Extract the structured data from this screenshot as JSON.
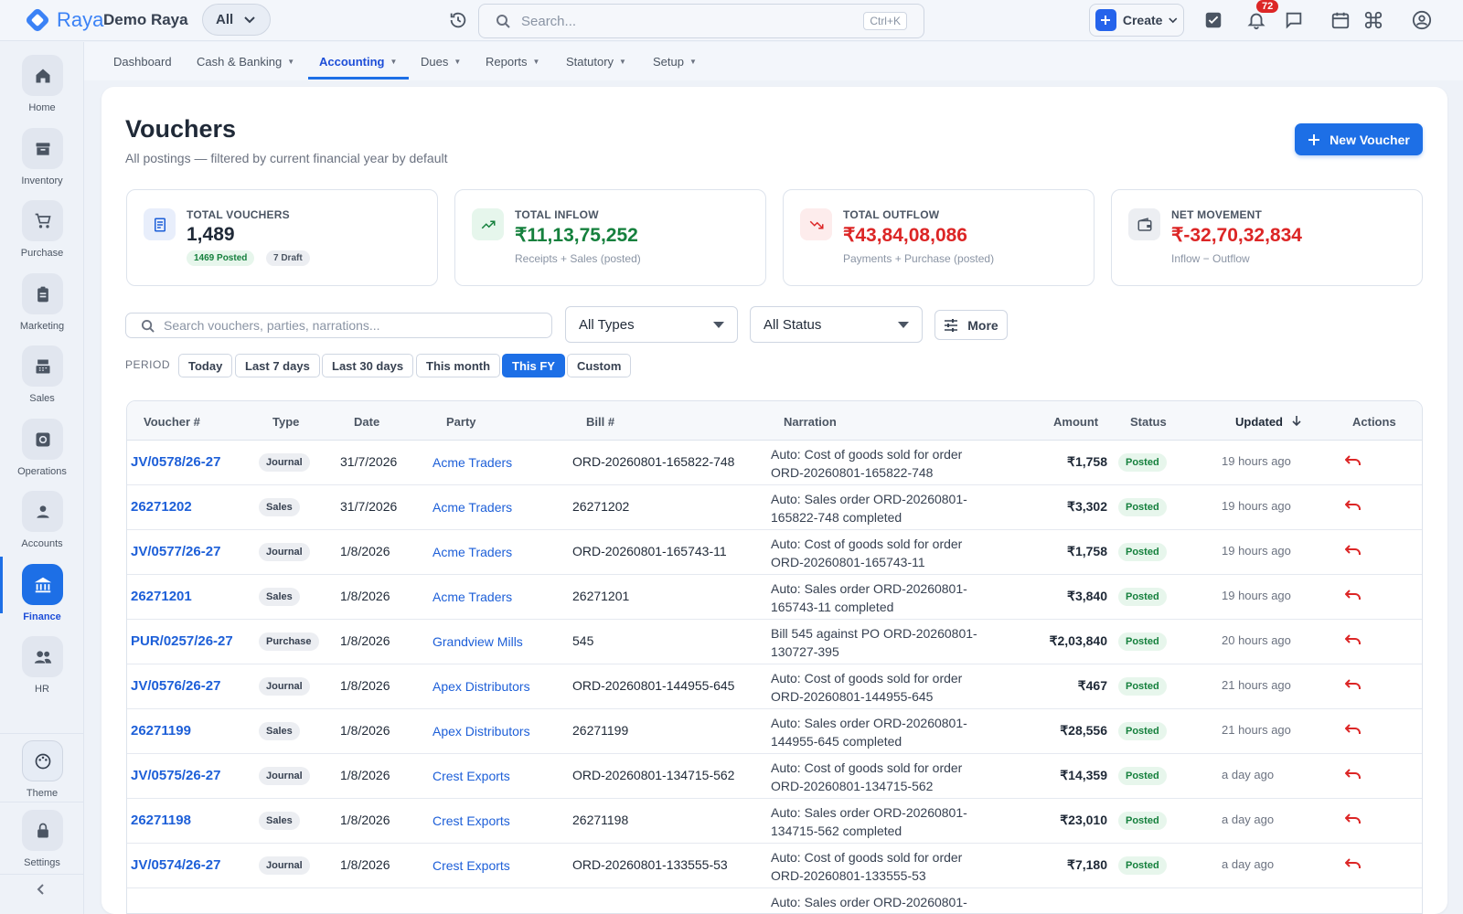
{
  "app": {
    "brand": "Raya",
    "company": "Demo Raya",
    "scope": "All",
    "search_placeholder": "Search...",
    "search_shortcut": "Ctrl+K",
    "create_label": "Create",
    "notification_count": "72"
  },
  "sidebar": {
    "items": [
      {
        "label": "Home",
        "icon": "home-icon"
      },
      {
        "label": "Inventory",
        "icon": "archive-icon"
      },
      {
        "label": "Purchase",
        "icon": "cart-icon"
      },
      {
        "label": "Marketing",
        "icon": "clipboard-icon"
      },
      {
        "label": "Sales",
        "icon": "register-icon"
      },
      {
        "label": "Operations",
        "icon": "gear-icon"
      },
      {
        "label": "Accounts",
        "icon": "person-icon"
      },
      {
        "label": "Finance",
        "icon": "bank-icon",
        "active": true
      },
      {
        "label": "HR",
        "icon": "people-icon"
      }
    ],
    "theme_label": "Theme",
    "settings_label": "Settings"
  },
  "subnav": {
    "tabs": [
      {
        "label": "Dashboard",
        "has_menu": false
      },
      {
        "label": "Cash & Banking",
        "has_menu": true
      },
      {
        "label": "Accounting",
        "has_menu": true,
        "active": true
      },
      {
        "label": "Dues",
        "has_menu": true
      },
      {
        "label": "Reports",
        "has_menu": true
      },
      {
        "label": "Statutory",
        "has_menu": true
      },
      {
        "label": "Setup",
        "has_menu": true
      }
    ]
  },
  "page": {
    "title": "Vouchers",
    "subtitle": "All postings — filtered by current financial year by default",
    "new_button": "New Voucher"
  },
  "stats": [
    {
      "label": "TOTAL VOUCHERS",
      "value": "1,489",
      "posted": "1469 Posted",
      "draft": "7 Draft",
      "color": "#1f2937"
    },
    {
      "label": "TOTAL INFLOW",
      "value": "₹11,13,75,252",
      "sub": "Receipts + Sales (posted)",
      "color": "#15803d"
    },
    {
      "label": "TOTAL OUTFLOW",
      "value": "₹43,84,08,086",
      "sub": "Payments + Purchase (posted)",
      "color": "#dc2626"
    },
    {
      "label": "NET MOVEMENT",
      "value": "₹-32,70,32,834",
      "sub": "Inflow − Outflow",
      "color": "#dc2626"
    }
  ],
  "filters": {
    "search_placeholder": "Search vouchers, parties, narrations...",
    "type_value": "All Types",
    "status_value": "All Status",
    "more_label": "More",
    "period_label": "PERIOD",
    "periods": [
      "Today",
      "Last 7 days",
      "Last 30 days",
      "This month",
      "This FY",
      "Custom"
    ],
    "active_period": "This FY"
  },
  "table": {
    "headers": [
      "Voucher #",
      "Type",
      "Date",
      "Party",
      "Bill #",
      "Narration",
      "Amount",
      "Status",
      "Updated",
      "Actions"
    ],
    "rows": [
      {
        "vno": "JV/0578/26-27",
        "type": "Journal",
        "date": "31/7/2026",
        "party": "Acme Traders",
        "bill": "ORD-20260801-165822-748",
        "narr1": "Auto: Cost of goods sold for order",
        "narr2": "ORD-20260801-165822-748",
        "amount": "₹1,758",
        "status": "Posted",
        "updated": "19 hours ago"
      },
      {
        "vno": "26271202",
        "type": "Sales",
        "date": "31/7/2026",
        "party": "Acme Traders",
        "bill": "26271202",
        "narr1": "Auto: Sales order ORD-20260801-",
        "narr2": "165822-748 completed",
        "amount": "₹3,302",
        "status": "Posted",
        "updated": "19 hours ago"
      },
      {
        "vno": "JV/0577/26-27",
        "type": "Journal",
        "date": "1/8/2026",
        "party": "Acme Traders",
        "bill": "ORD-20260801-165743-11",
        "narr1": "Auto: Cost of goods sold for order",
        "narr2": "ORD-20260801-165743-11",
        "amount": "₹1,758",
        "status": "Posted",
        "updated": "19 hours ago"
      },
      {
        "vno": "26271201",
        "type": "Sales",
        "date": "1/8/2026",
        "party": "Acme Traders",
        "bill": "26271201",
        "narr1": "Auto: Sales order ORD-20260801-",
        "narr2": "165743-11 completed",
        "amount": "₹3,840",
        "status": "Posted",
        "updated": "19 hours ago"
      },
      {
        "vno": "PUR/0257/26-27",
        "type": "Purchase",
        "date": "1/8/2026",
        "party": "Grandview Mills",
        "bill": "545",
        "narr1": "Bill 545 against PO ORD-20260801-",
        "narr2": "130727-395",
        "amount": "₹2,03,840",
        "status": "Posted",
        "updated": "20 hours ago"
      },
      {
        "vno": "JV/0576/26-27",
        "type": "Journal",
        "date": "1/8/2026",
        "party": "Apex Distributors",
        "bill": "ORD-20260801-144955-645",
        "narr1": "Auto: Cost of goods sold for order",
        "narr2": "ORD-20260801-144955-645",
        "amount": "₹467",
        "status": "Posted",
        "updated": "21 hours ago"
      },
      {
        "vno": "26271199",
        "type": "Sales",
        "date": "1/8/2026",
        "party": "Apex Distributors",
        "bill": "26271199",
        "narr1": "Auto: Sales order ORD-20260801-",
        "narr2": "144955-645 completed",
        "amount": "₹28,556",
        "status": "Posted",
        "updated": "21 hours ago"
      },
      {
        "vno": "JV/0575/26-27",
        "type": "Journal",
        "date": "1/8/2026",
        "party": "Crest Exports",
        "bill": "ORD-20260801-134715-562",
        "narr1": "Auto: Cost of goods sold for order",
        "narr2": "ORD-20260801-134715-562",
        "amount": "₹14,359",
        "status": "Posted",
        "updated": "a day ago"
      },
      {
        "vno": "26271198",
        "type": "Sales",
        "date": "1/8/2026",
        "party": "Crest Exports",
        "bill": "26271198",
        "narr1": "Auto: Sales order ORD-20260801-",
        "narr2": "134715-562 completed",
        "amount": "₹23,010",
        "status": "Posted",
        "updated": "a day ago"
      },
      {
        "vno": "JV/0574/26-27",
        "type": "Journal",
        "date": "1/8/2026",
        "party": "Crest Exports",
        "bill": "ORD-20260801-133555-53",
        "narr1": "Auto: Cost of goods sold for order",
        "narr2": "ORD-20260801-133555-53",
        "amount": "₹7,180",
        "status": "Posted",
        "updated": "a day ago"
      },
      {
        "vno": "",
        "type": "",
        "date": "",
        "party": "",
        "bill": "",
        "narr1": "Auto: Sales order ORD-20260801-",
        "narr2": "",
        "amount": "",
        "status": "",
        "updated": ""
      }
    ]
  },
  "colors": {
    "accent": "#1d6fe6",
    "posted_bg": "#e7f6ec",
    "posted_fg": "#15803d",
    "danger": "#dc2626"
  }
}
